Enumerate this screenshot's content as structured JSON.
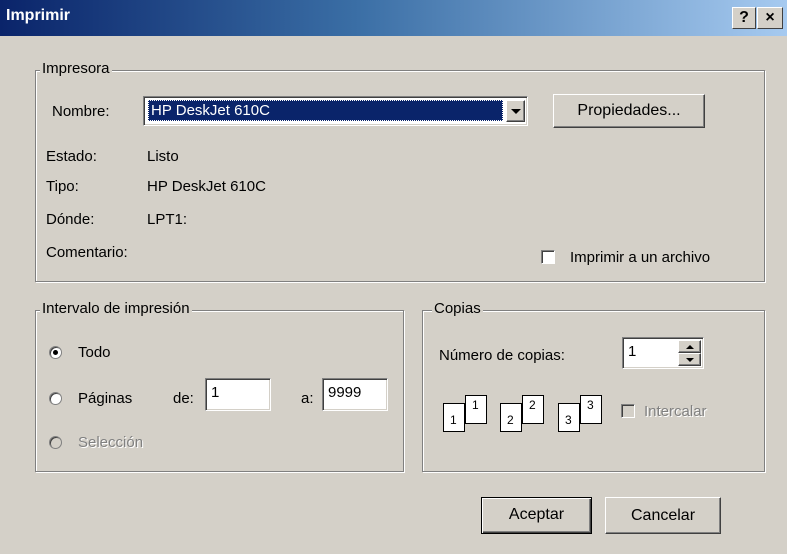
{
  "window": {
    "title": "Imprimir",
    "help_glyph": "?",
    "close_glyph": "×"
  },
  "printer": {
    "group_label": "Impresora",
    "name_label": "Nombre:",
    "name_value": "HP DeskJet 610C",
    "properties_button": "Propiedades...",
    "status_label": "Estado:",
    "status_value": "Listo",
    "type_label": "Tipo:",
    "type_value": "HP DeskJet 610C",
    "where_label": "Dónde:",
    "where_value": "LPT1:",
    "comment_label": "Comentario:",
    "print_to_file_label": "Imprimir a un archivo",
    "print_to_file_checked": false
  },
  "range": {
    "group_label": "Intervalo de impresión",
    "all_label": "Todo",
    "pages_label": "Páginas",
    "from_label": "de:",
    "from_value": "1",
    "to_label": "a:",
    "to_value": "9999",
    "selection_label": "Selección",
    "selected": "all"
  },
  "copies": {
    "group_label": "Copias",
    "count_label": "Número de copias:",
    "count_value": "1",
    "collate_label": "Intercalar",
    "collate_pages": [
      "1",
      "2",
      "3"
    ]
  },
  "buttons": {
    "ok": "Aceptar",
    "cancel": "Cancelar"
  }
}
